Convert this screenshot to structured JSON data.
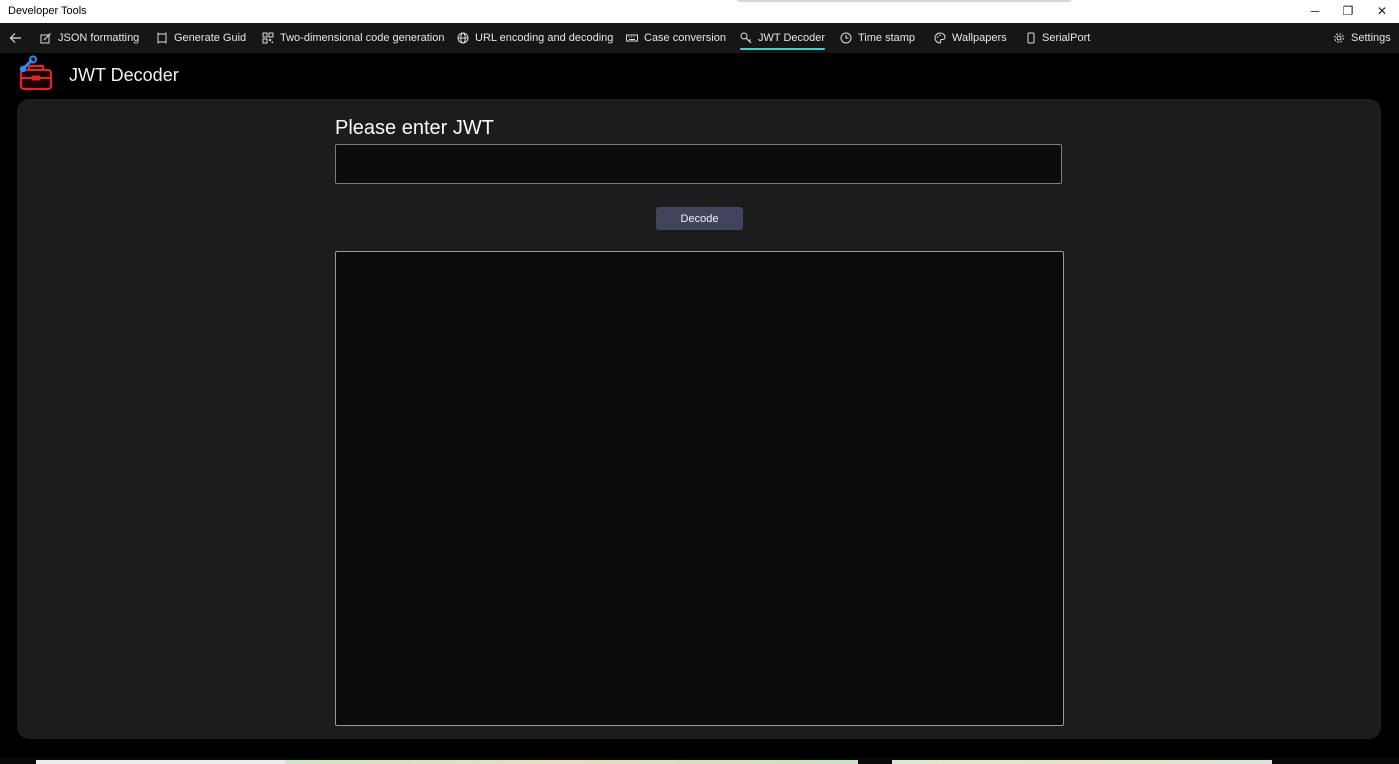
{
  "window": {
    "title": "Developer Tools",
    "controls": {
      "minimize": "─",
      "maximize": "❐",
      "close": "✕"
    }
  },
  "nav": {
    "back_icon": "back-arrow-icon",
    "items": [
      {
        "label": "JSON formatting",
        "icon": "edit-icon"
      },
      {
        "label": "Generate Guid",
        "icon": "frame-icon"
      },
      {
        "label": "Two-dimensional code generation",
        "icon": "qr-icon"
      },
      {
        "label": "URL encoding and decoding",
        "icon": "globe-icon"
      },
      {
        "label": "Case conversion",
        "icon": "keyboard-icon"
      },
      {
        "label": "JWT Decoder",
        "icon": "key-icon",
        "active": true
      },
      {
        "label": "Time stamp",
        "icon": "clock-icon"
      },
      {
        "label": "Wallpapers",
        "icon": "palette-icon"
      },
      {
        "label": "SerialPort",
        "icon": "device-icon"
      }
    ],
    "settings_label": "Settings",
    "accent_color": "#48d1c3"
  },
  "header": {
    "title": "JWT Decoder",
    "logo_icon": "toolbox-icon"
  },
  "main": {
    "input_label": "Please enter JWT",
    "input_value": "",
    "decode_button": "Decode",
    "output_value": ""
  },
  "colors": {
    "background": "#000000",
    "card": "#1c1c1c",
    "button": "#42435d",
    "nav_bar": "#161616"
  }
}
